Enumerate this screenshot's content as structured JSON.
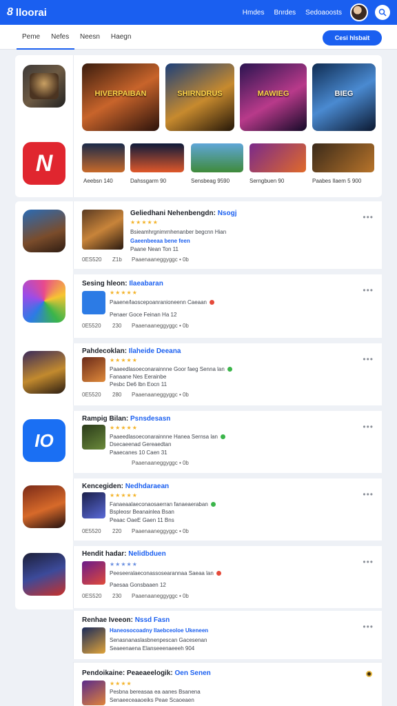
{
  "header": {
    "logo_text": "lloorai",
    "nav": [
      "Hmdes",
      "Bnrdes",
      "Sedoaoosts"
    ]
  },
  "tabs": {
    "items": [
      "Peme",
      "Nefes",
      "Neesn",
      "Haegn"
    ],
    "cta_label": "Cesi hlsbait"
  },
  "featured": {
    "banners": [
      "HIVERPAIBAN",
      "SHIRNDRUS",
      "MAWIEG",
      "BIEG"
    ],
    "thumbs": [
      "Aeebsn 140",
      "Dahssgarm 90",
      "Sensbeag 9590",
      "Serngbuen 90",
      "Paabes Ilaem 5 900"
    ]
  },
  "rows": [
    {
      "title": "Geliedhani Nehenbengdn:",
      "title_hl": "Nsogj",
      "stars": "★★★★★",
      "line1": "Bsieamhrgnimrnhenanber begcnn Hian",
      "line2": "Gaeenbeeaa bene feen",
      "line3": "Paane Nean Ton 11",
      "meta_a": "0ES520",
      "meta_b": "Z1b",
      "meta_c": "Paaenaaneggyggc • 0b"
    },
    {
      "title": "Sesing hleon:",
      "title_hl": "Ilaeabaran",
      "stars": "★★★★★",
      "line1": "Paaene/laoscepoanranioneenn Caeaan",
      "line2": "Penaer Goce Feinan Ha 12",
      "line3": "",
      "meta_a": "0E5520",
      "meta_b": "230",
      "meta_c": "Paaenaaneggyggc • 0b"
    },
    {
      "title": "Pahdecoklan:",
      "title_hl": "Ilaheide Deeana",
      "stars": "★★★★★",
      "line1": "Paaeedlasoeconarainnne Goor faeg Senna lan",
      "line2": "Fanaane Nes Eerainbe",
      "line3": "Pesbc De6 lbn Eocn 11",
      "meta_a": "0E5520",
      "meta_b": "280",
      "meta_c": "Paaenaaneggyggc • 0b"
    },
    {
      "title": "Rampig Bilan:",
      "title_hl": "Psnsdesasn",
      "stars": "★★★★★",
      "line1": "Paaeedlasoeconarainnne Hanea Sernsa lan",
      "line2": "Dsecaeenad Gereaedtan",
      "line3": "Paaecanes 10 Caen 31",
      "meta_a": "",
      "meta_b": "",
      "meta_c": "Paaenaaneggyggc • 0b"
    },
    {
      "title": "Kencegiden:",
      "title_hl": "Nedhdaraean",
      "stars": "★★★★★",
      "line1": "Fanaeaalaeconaosaerran fanaeaeraban",
      "line2": "Bspleosr Beanainlea Bsan",
      "line3": "Peaac OaeE Gaen 11 Bns",
      "meta_a": "0E5520",
      "meta_b": "220",
      "meta_c": "Paaenaaneggyggc • 0b"
    },
    {
      "title": "Hendit hadar:",
      "title_hl": "Nelidbduen",
      "stars": "★★★★★",
      "line1": "Peeseeralaeconassosearannaa Saeaa lan",
      "line2": "Paesaa Gonsbaaen 12",
      "line3": "",
      "meta_a": "0ES520",
      "meta_b": "230",
      "meta_c": "Paaenaaneggyggc • 0b"
    },
    {
      "title": "Renhae Iveeon:",
      "title_hl": "Nssd Fasn",
      "stars": "",
      "line1": "Haneosocoadny Ilaebceoloe Ukeneen",
      "line2": "Senasnanaslasbnenpescan Gacesenan",
      "line3": "Seaeenaena Elanseeenaeeeh 904",
      "meta_a": "",
      "meta_b": "",
      "meta_c": ""
    },
    {
      "title": "Pendoikaine: Peaeaeelogik:",
      "title_hl": "Oen Senen",
      "stars": "★★★★",
      "line1": "Pesbna bereasaa ea aanes Bsanena",
      "line2": "Senaeeceaaoeiks Peae Scaoeaen",
      "line3": "",
      "meta_a": "",
      "meta_b": "",
      "meta_c": ""
    }
  ],
  "colors": {
    "brand": "#1a5ff0",
    "star": "#f3b227"
  }
}
